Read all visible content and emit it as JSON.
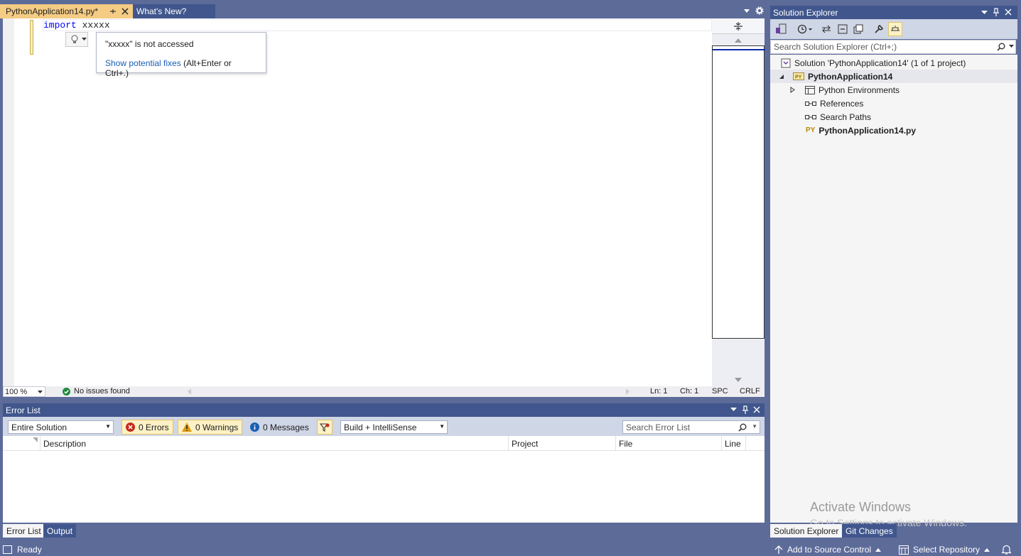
{
  "tabs": [
    {
      "label": "PythonApplication14.py*",
      "active": true
    },
    {
      "label": "What's New?",
      "active": false
    }
  ],
  "editor": {
    "code": {
      "keyword": "import",
      "module": "xxxxx"
    },
    "quickinfo": {
      "message": "\"xxxxx\" is not accessed",
      "fix_link": "Show potential fixes",
      "fix_shortcut": " (Alt+Enter or Ctrl+.)"
    },
    "status": {
      "zoom": "100 %",
      "health": "No issues found",
      "line": "Ln: 1",
      "col": "Ch: 1",
      "whitespace": "SPC",
      "eol": "CRLF"
    }
  },
  "error_list": {
    "title": "Error List",
    "scope": "Entire Solution",
    "errors": "0 Errors",
    "warnings": "0 Warnings",
    "messages": "0 Messages",
    "source": "Build + IntelliSense",
    "search_placeholder": "Search Error List",
    "columns": [
      "Description",
      "Project",
      "File",
      "Line"
    ]
  },
  "panel_tabs": [
    "Error List",
    "Output"
  ],
  "solution_explorer": {
    "title": "Solution Explorer",
    "search_placeholder": "Search Solution Explorer (Ctrl+;)",
    "solution": "Solution 'PythonApplication14' (1 of 1 project)",
    "project": "PythonApplication14",
    "items": [
      "Python Environments",
      "References",
      "Search Paths",
      "PythonApplication14.py"
    ],
    "bottom_tabs": [
      "Solution Explorer",
      "Git Changes"
    ]
  },
  "watermark": {
    "line1": "Activate Windows",
    "line2": "Go to Settings to activate Windows."
  },
  "statusbar": {
    "ready": "Ready",
    "source_control": "Add to Source Control",
    "repository": "Select Repository"
  },
  "colors": {
    "chrome": "#5d6b99",
    "title_active": "#40568d",
    "active_tab": "#f5cc84",
    "toolbar": "#cfd6e5",
    "link": "#1a5fb4",
    "keyword": "#0000ff"
  }
}
